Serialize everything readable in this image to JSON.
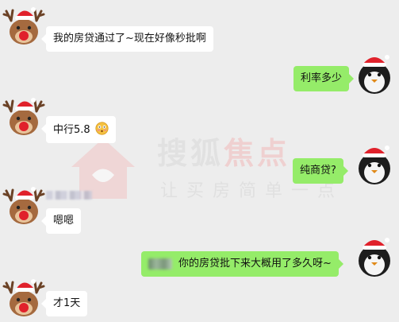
{
  "messages": [
    {
      "side": "left",
      "text": "我的房贷通过了~现在好像秒批啊"
    },
    {
      "side": "right",
      "text": "利率多少"
    },
    {
      "side": "left",
      "text": "中行5.8",
      "emoji": "flushed-face-icon"
    },
    {
      "side": "right",
      "text": "纯商贷?"
    },
    {
      "side": "left",
      "text": "嗯嗯"
    },
    {
      "side": "right",
      "text": "你的房贷批下来大概用了多久呀~"
    },
    {
      "side": "left",
      "text": "才1天"
    }
  ],
  "watermark": {
    "brand_a": "搜狐",
    "brand_b": "焦点",
    "slogan": "让买房简单一点"
  },
  "colors": {
    "background": "#ededed",
    "left_bubble": "#ffffff",
    "right_bubble": "#95ec69",
    "watermark_red": "#e23a3a"
  }
}
